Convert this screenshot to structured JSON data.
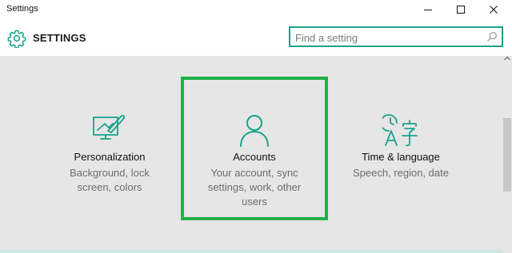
{
  "window": {
    "title": "Settings"
  },
  "header": {
    "title": "SETTINGS",
    "icon": "gear-icon"
  },
  "search": {
    "placeholder": "Find a setting",
    "value": ""
  },
  "tiles": [
    {
      "name": "Personalization",
      "description": "Background, lock screen, colors",
      "icon": "personalization-icon",
      "selected": false
    },
    {
      "name": "Accounts",
      "description": "Your account, sync settings, work, other users",
      "icon": "person-icon",
      "selected": true
    },
    {
      "name": "Time & language",
      "description": "Speech, region, date",
      "icon": "time-language-icon",
      "selected": false
    }
  ],
  "colors": {
    "accent": "#1aa38b",
    "selection": "#21b04a",
    "background": "#e6e6e6"
  }
}
